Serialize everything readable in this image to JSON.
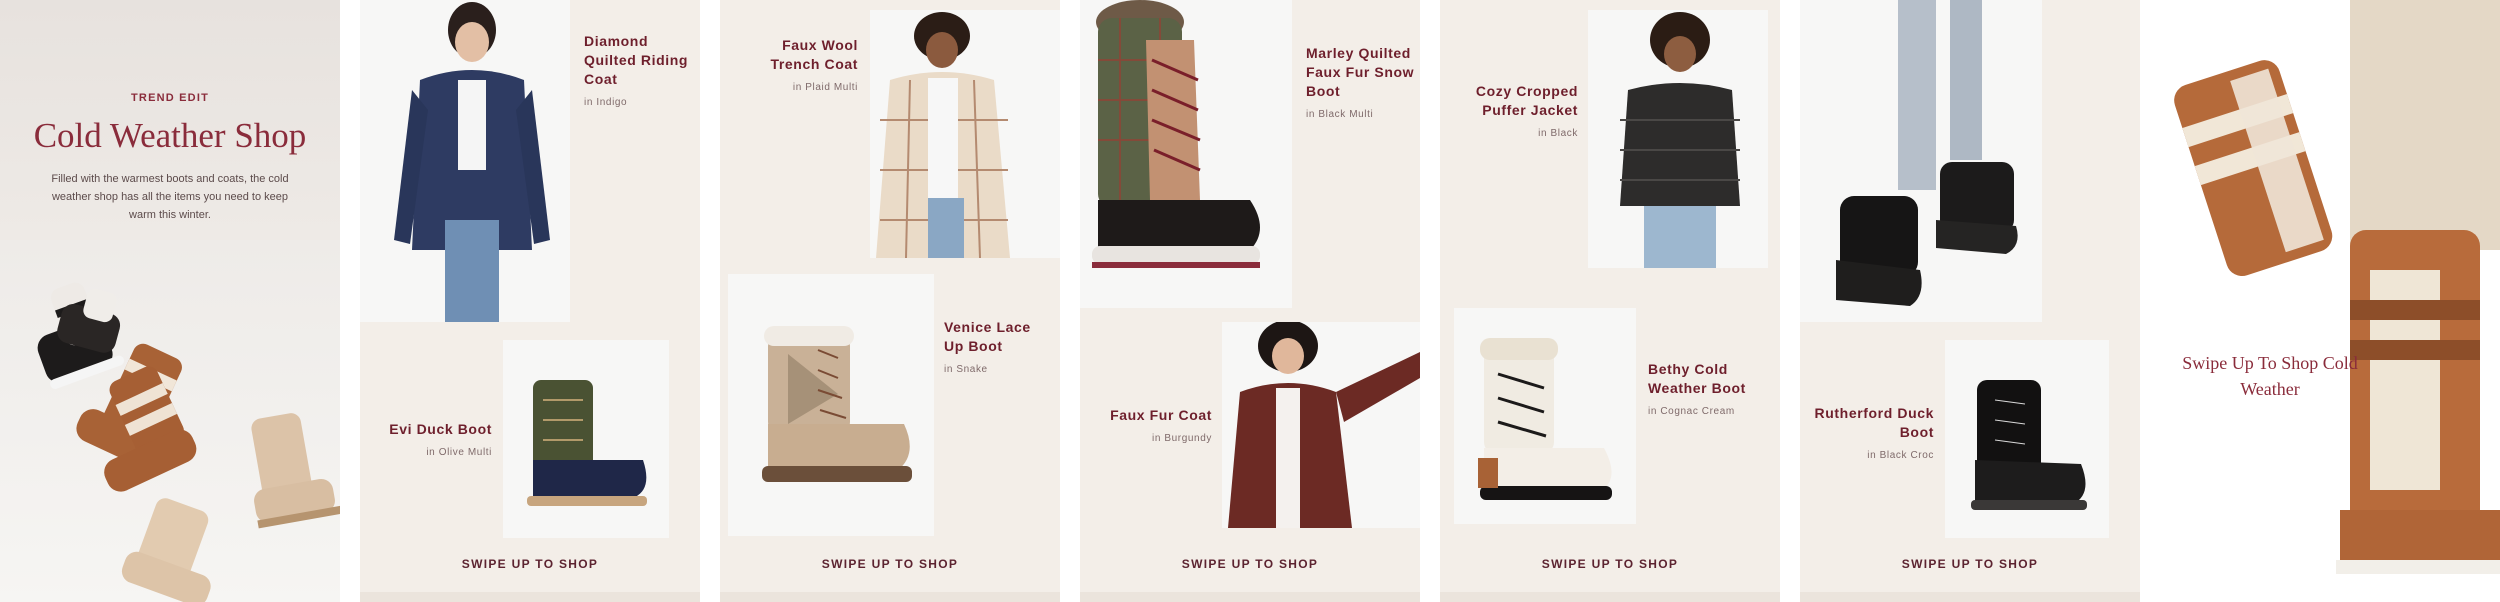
{
  "hero": {
    "eyebrow": "TREND EDIT",
    "title": "Cold Weather Shop",
    "description": "Filled with the warmest boots and coats, the cold weather shop has all the items you need to keep warm this winter."
  },
  "panels": [
    {
      "top": {
        "name": "Diamond Quilted Riding Coat",
        "color": "in Indigo"
      },
      "bottom": {
        "name": "Evi Duck Boot",
        "color": "in Olive Multi"
      },
      "cta": "SWIPE UP TO SHOP"
    },
    {
      "top": {
        "name": "Faux Wool Trench Coat",
        "color": "in Plaid Multi"
      },
      "bottom": {
        "name": "Venice Lace Up Boot",
        "color": "in Snake"
      },
      "cta": "SWIPE UP TO SHOP"
    },
    {
      "top": {
        "name": "Marley Quilted Faux Fur Snow Boot",
        "color": "in Black Multi"
      },
      "bottom": {
        "name": "Faux Fur Coat",
        "color": "in Burgundy"
      },
      "cta": "SWIPE UP TO SHOP"
    },
    {
      "top": {
        "name": "Cozy Cropped Puffer Jacket",
        "color": "in Black"
      },
      "bottom": {
        "name": "Bethy Cold Weather Boot",
        "color": "in Cognac Cream"
      },
      "cta": "SWIPE UP TO SHOP"
    },
    {
      "top": {
        "name": "",
        "color": ""
      },
      "bottom": {
        "name": "Rutherford Duck Boot",
        "color": "in Black Croc"
      },
      "cta": "SWIPE UP TO SHOP"
    }
  ],
  "end": {
    "text": "Swipe Up To Shop Cold Weather"
  },
  "colors": {
    "accent": "#8a2c3b",
    "panel_bg": "#f3eee8",
    "tile_bg": "#f7f7f6"
  },
  "icons": [
    "coat-photo",
    "boot-photo"
  ]
}
